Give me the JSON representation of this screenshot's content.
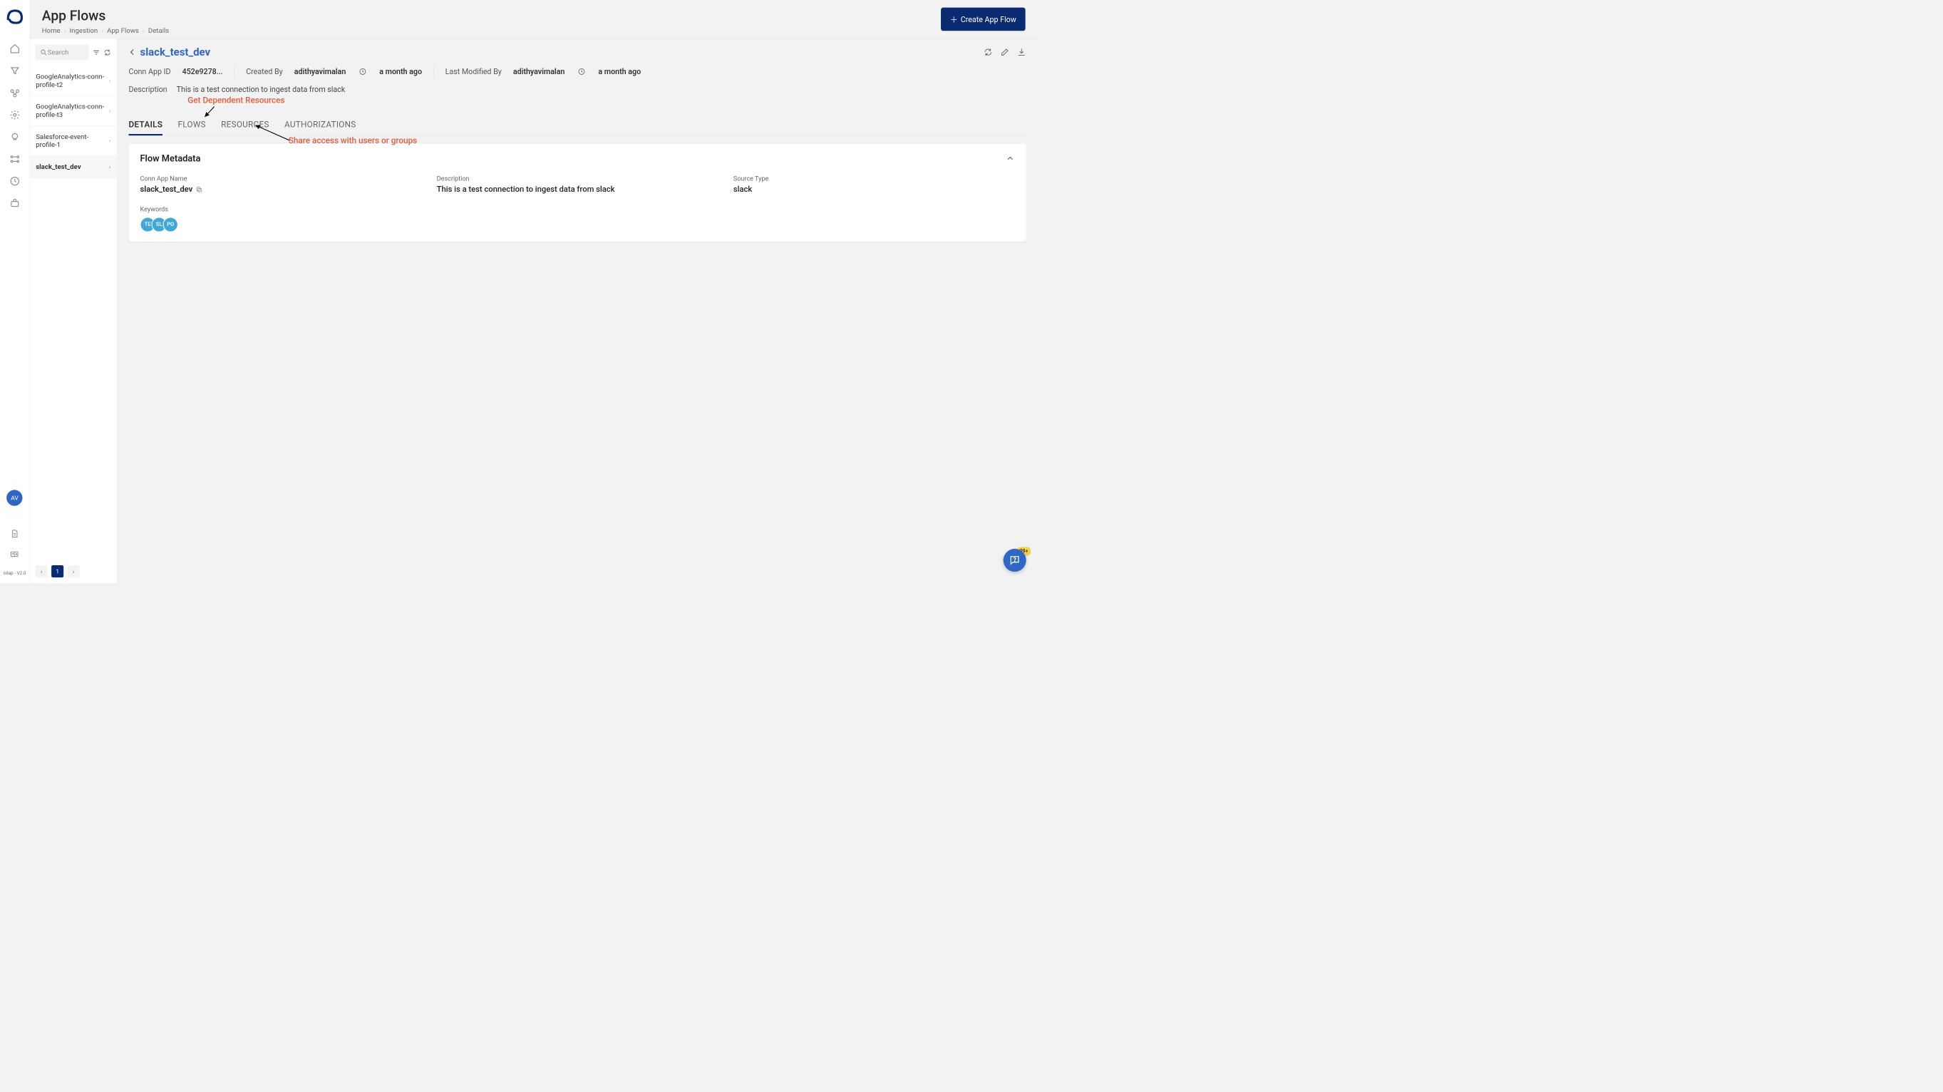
{
  "header": {
    "title": "App Flows",
    "create_button": "Create App Flow"
  },
  "breadcrumbs": [
    "Home",
    "Ingestion",
    "App Flows",
    "Details"
  ],
  "rail": {
    "avatar_initials": "AV",
    "version": "cdap - V2.0"
  },
  "sidepanel": {
    "search_placeholder": "Search",
    "items": [
      {
        "label": "GoogleAnalytics-conn-profile-t2",
        "selected": false
      },
      {
        "label": "GoogleAnalytics-conn-profile-t3",
        "selected": false
      },
      {
        "label": "Salesforce-event-profile-1",
        "selected": false
      },
      {
        "label": "slack_test_dev",
        "selected": true
      }
    ],
    "current_page": "1"
  },
  "detail": {
    "title": "slack_test_dev",
    "app_id_label": "Conn App ID",
    "app_id_value": "452e9278...",
    "created_by_label": "Created By",
    "created_by_value": "adithyavimalan",
    "created_ago": "a month ago",
    "modified_by_label": "Last Modified By",
    "modified_by_value": "adithyavimalan",
    "modified_ago": "a month ago",
    "desc_label": "Description",
    "desc_value": "This is a test connection to ingest data from slack",
    "tabs": [
      "DETAILS",
      "FLOWS",
      "RESOURCES",
      "AUTHORIZATIONS"
    ],
    "active_tab": 0,
    "annotations": {
      "resources": "Get Dependent Resources",
      "authorizations": "Share access with users or groups"
    },
    "card": {
      "title": "Flow Metadata",
      "fields": {
        "name_label": "Conn App Name",
        "name_value": "slack_test_dev",
        "desc_label": "Description",
        "desc_value": "This is a test connection to ingest data from slack",
        "source_type_label": "Source Type",
        "source_type_value": "slack",
        "keywords_label": "Keywords",
        "keyword_chips": [
          "TE",
          "SL",
          "PO"
        ]
      }
    }
  },
  "fab_badge": "99+"
}
